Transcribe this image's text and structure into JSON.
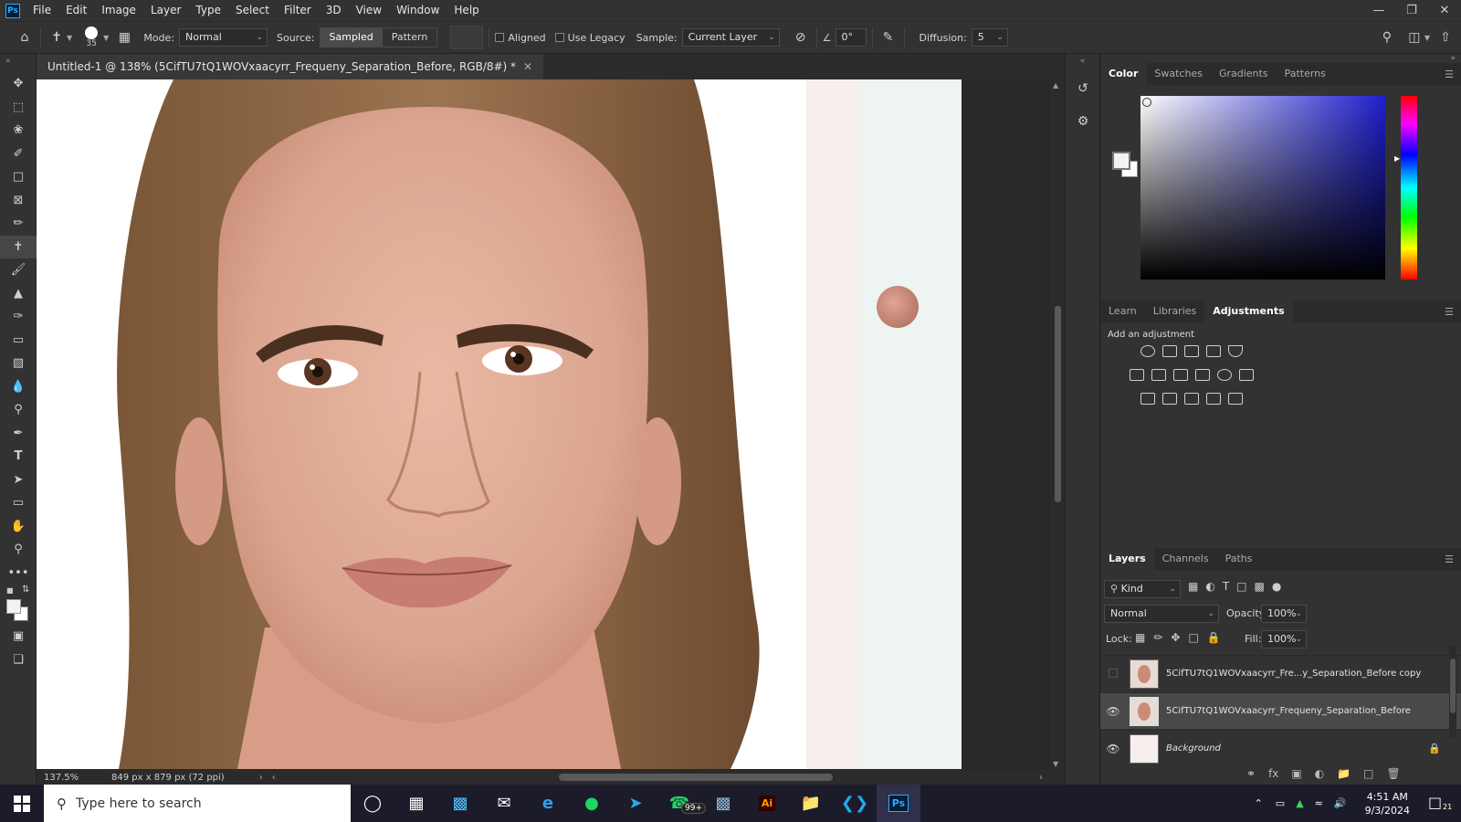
{
  "menubar": {
    "app_icon": "Ps",
    "items": [
      "File",
      "Edit",
      "Image",
      "Layer",
      "Type",
      "Select",
      "Filter",
      "3D",
      "View",
      "Window",
      "Help"
    ]
  },
  "options": {
    "brush_size": "35",
    "mode_label": "Mode:",
    "mode_value": "Normal",
    "source_label": "Source:",
    "source_sampled": "Sampled",
    "source_pattern": "Pattern",
    "aligned_label": "Aligned",
    "use_legacy_label": "Use Legacy",
    "sample_label": "Sample:",
    "sample_value": "Current Layer",
    "angle_value": "0°",
    "diffusion_label": "Diffusion:",
    "diffusion_value": "5"
  },
  "document": {
    "tab_title": "Untitled-1 @ 138% (5CifTU7tQ1WOVxaacyrr_Frequeny_Separation_Before, RGB/8#) *"
  },
  "status": {
    "zoom": "137.5%",
    "doc_size": "849 px x 879 px (72 ppi)"
  },
  "color_panel": {
    "tabs": [
      "Color",
      "Swatches",
      "Gradients",
      "Patterns"
    ],
    "active_tab": "Color"
  },
  "adjust_panel": {
    "tabs": [
      "Learn",
      "Libraries",
      "Adjustments"
    ],
    "active_tab": "Adjustments",
    "hint": "Add an adjustment"
  },
  "layers_panel": {
    "tabs": [
      "Layers",
      "Channels",
      "Paths"
    ],
    "active_tab": "Layers",
    "filter_kind": "Kind",
    "blend_mode": "Normal",
    "opacity_label": "Opacity:",
    "opacity_value": "100%",
    "lock_label": "Lock:",
    "fill_label": "Fill:",
    "fill_value": "100%",
    "layers": [
      {
        "name": "5CifTU7tQ1WOVxaacyrr_Fre...y_Separation_Before copy",
        "visible": false,
        "selected": false
      },
      {
        "name": "5CifTU7tQ1WOVxaacyrr_Frequeny_Separation_Before",
        "visible": true,
        "selected": true
      },
      {
        "name": "Background",
        "visible": true,
        "selected": false,
        "locked": true
      }
    ]
  },
  "taskbar": {
    "search_placeholder": "Type here to search",
    "whatsapp_badge": "99+",
    "time": "4:51 AM",
    "date": "9/3/2024",
    "notifications": "21"
  },
  "colors": {
    "accent": "#31a8ff",
    "panel_bg": "#323232",
    "canvas_bg": "#ffffff"
  }
}
